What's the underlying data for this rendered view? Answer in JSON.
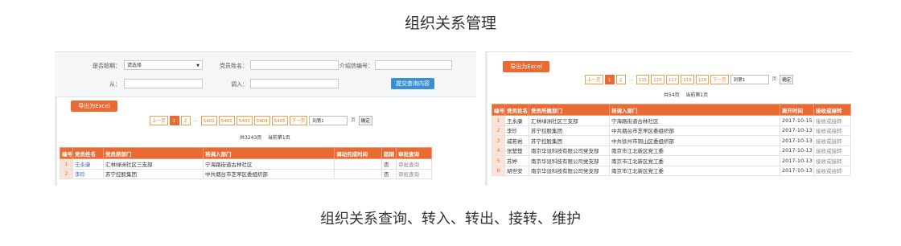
{
  "header": {
    "title": "组织关系管理"
  },
  "caption": "组织关系查询、转入、转出、接转、维护",
  "left": {
    "filters": {
      "dormant_label": "是否超期：",
      "dormant_value": "请选择",
      "member_name_label": "党员姓名：",
      "letter_no_label": "介绍信编号：",
      "from_label": "从：",
      "transfer_in_label": "调入：",
      "submit_label": "提交查询内容"
    },
    "export_label": "导出为Excel",
    "pager": {
      "prev": "上一页",
      "pages": [
        "1",
        "2",
        "...",
        "5401",
        "5402",
        "5403",
        "5404",
        "5405"
      ],
      "next": "下一页",
      "jump_value": "到第1",
      "page_unit": "页",
      "confirm": "确定",
      "total": "共3243页",
      "current": "当前第1页"
    },
    "table": {
      "headers": [
        "编号",
        "党员姓名",
        "党员原部门",
        "将调入部门",
        "调动完成时间",
        "超期",
        "审批查询"
      ],
      "rows": [
        [
          "1",
          "王永康",
          "汇林绿洲社区三支部",
          "宁海路街道古林社区",
          "",
          "否",
          "审批查询"
        ],
        [
          "2",
          "李珍",
          "苏宁控股集团",
          "中共烟台市芝罘区委组织部",
          "",
          "否",
          "审批查询"
        ]
      ]
    }
  },
  "right": {
    "export_label": "导出为Excel",
    "pager": {
      "prev": "上一页",
      "pages": [
        "1",
        "2",
        "...",
        "115",
        "116",
        "117",
        "118",
        "119"
      ],
      "next": "下一页",
      "jump_value": "到第1",
      "page_unit": "页",
      "confirm": "确定",
      "total": "共54页",
      "current": "当前第1页"
    },
    "table": {
      "headers": [
        "编号",
        "党员姓名",
        "党员所属部门",
        "将调入部门",
        "离开时间",
        "接收或接转"
      ],
      "rows": [
        [
          "1",
          "王永康",
          "汇林绿洲社区三支部",
          "宁海路街道古林社区",
          "2017-10-15",
          "接收或接转"
        ],
        [
          "2",
          "李珍",
          "苏宁控股集团",
          "中共烟台市芝罘区委组织部",
          "2017-10-13",
          "接收或接转"
        ],
        [
          "3",
          "戚若岩",
          "苏宁控股集团",
          "中共徐州市铜山区委组织部",
          "2017-10-13",
          "接收或接转"
        ],
        [
          "4",
          "张楚楚",
          "南京华设科技有限公司党支部",
          "南京市江北新区党工委",
          "2017-10-13",
          "接收或接转"
        ],
        [
          "5",
          "苏婷",
          "南京华设科技有限公司党支部",
          "南京市江北新区党工委",
          "2017-10-13",
          "接收或接转"
        ],
        [
          "6",
          "胡世安",
          "南京华设科技有限公司党支部",
          "南京市江北新区党工委",
          "2017-10-13",
          "接收或接转"
        ]
      ]
    }
  }
}
